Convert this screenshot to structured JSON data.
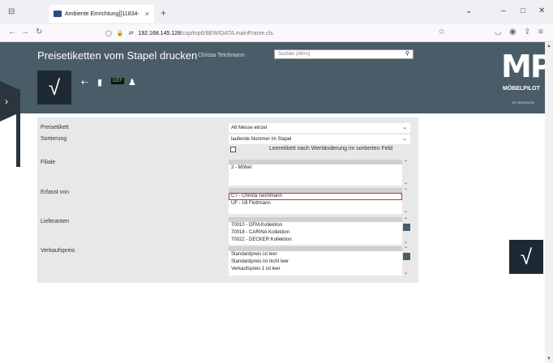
{
  "browser": {
    "tab_title": "Ambiente Einrichtung[[11834-",
    "url_host": "192.168.145.128",
    "url_path": "/csp/mp6/BEWIDATA.mainFrame.cls"
  },
  "header": {
    "title": "Preisetiketten vom Stapel drucken",
    "user": "Christa Teichmann",
    "search_placeholder": "Suchen (Alt+s)",
    "logo": "MP.",
    "logo_text": "MÖBELPILOT",
    "logo_sub": "BY BEWIDATA",
    "confirm_symbol": "√"
  },
  "form": {
    "preisetikett": {
      "label": "Preisetikett",
      "value": "A6 Messe einzel"
    },
    "sortierung": {
      "label": "Sortierung",
      "value": "laufende Nummer im Stapel"
    },
    "leeretikett": {
      "label": "Leeretikett nach Wertänderung im sortierten Feld",
      "checked": false
    },
    "filiale": {
      "label": "Filiale",
      "options": [
        "2 - Möbel"
      ]
    },
    "erfasst_von": {
      "label": "Erfasst von",
      "options": [
        "CT - Christa Teichmann",
        "UF - Uli Flottmann"
      ],
      "selected": 0
    },
    "lieferanten": {
      "label": "Lieferanten",
      "options": [
        "70010 - DFM-Kollektion",
        "70018 - CARINA Kollektion",
        "70022 - DECKER Kollektion"
      ]
    },
    "verkaufspreis": {
      "label": "Verkaufspreis",
      "options": [
        "Standardpreis ist leer",
        "Standardpreis ist nicht leer",
        "Verkaufspreis 1 ist leer"
      ]
    }
  },
  "colors": {
    "header_bg": "#4b5c69",
    "accent_dark": "#1e2a33",
    "selection": "#c0302a"
  }
}
